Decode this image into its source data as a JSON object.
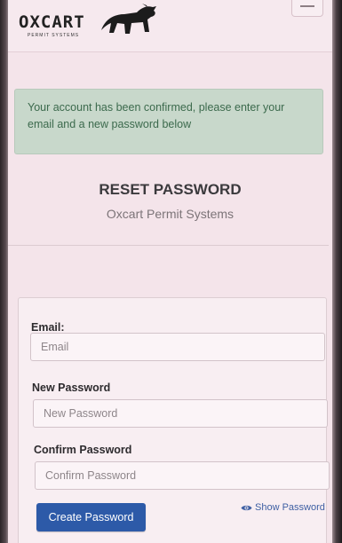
{
  "brand": {
    "name": "OXCART",
    "tagline": "PERMIT SYSTEMS"
  },
  "alert": {
    "message": "Your account has been confirmed, please enter your email and a new password below"
  },
  "page": {
    "title": "RESET PASSWORD",
    "subtitle": "Oxcart Permit Systems"
  },
  "form": {
    "email": {
      "label": "Email:",
      "placeholder": "Email",
      "value": ""
    },
    "new_password": {
      "label": "New Password",
      "placeholder": "New Password",
      "value": ""
    },
    "confirm_password": {
      "label": "Confirm Password",
      "placeholder": "Confirm Password",
      "value": ""
    },
    "submit_label": "Create Password",
    "show_password_label": "Show Password"
  },
  "colors": {
    "primary": "#2d5aa8",
    "alert_bg": "#c8d8cb",
    "alert_text": "#3c6a4d"
  },
  "icons": {
    "logo": "bull-icon",
    "menu": "menu-icon",
    "show_password": "eye-icon"
  }
}
